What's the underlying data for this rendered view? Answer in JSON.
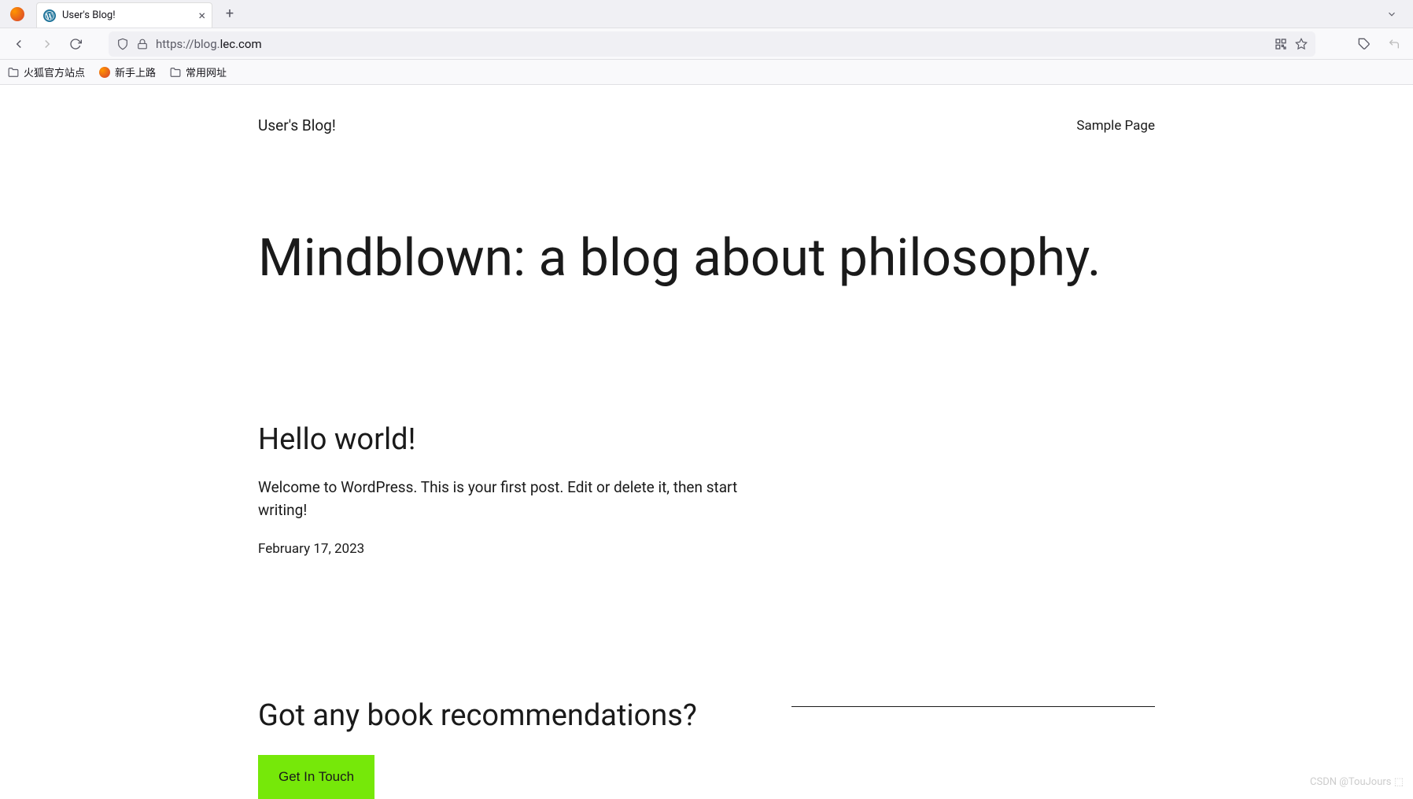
{
  "browser": {
    "tab": {
      "title": "User's Blog!"
    },
    "url_prefix": "https://blog.",
    "url_domain": "lec.com",
    "bookmarks": [
      {
        "label": "火狐官方站点",
        "icon": "folder"
      },
      {
        "label": "新手上路",
        "icon": "firefox"
      },
      {
        "label": "常用网址",
        "icon": "folder"
      }
    ]
  },
  "site": {
    "title": "User's Blog!",
    "nav_link": "Sample Page",
    "hero": "Mindblown: a blog about philosophy."
  },
  "post": {
    "title": "Hello world!",
    "content": "Welcome to WordPress. This is your first post. Edit or delete it, then start writing!",
    "date": "February 17, 2023"
  },
  "cta": {
    "title": "Got any book recommendations?",
    "button": "Get In Touch"
  },
  "watermark": "CSDN @TouJours ⬚"
}
